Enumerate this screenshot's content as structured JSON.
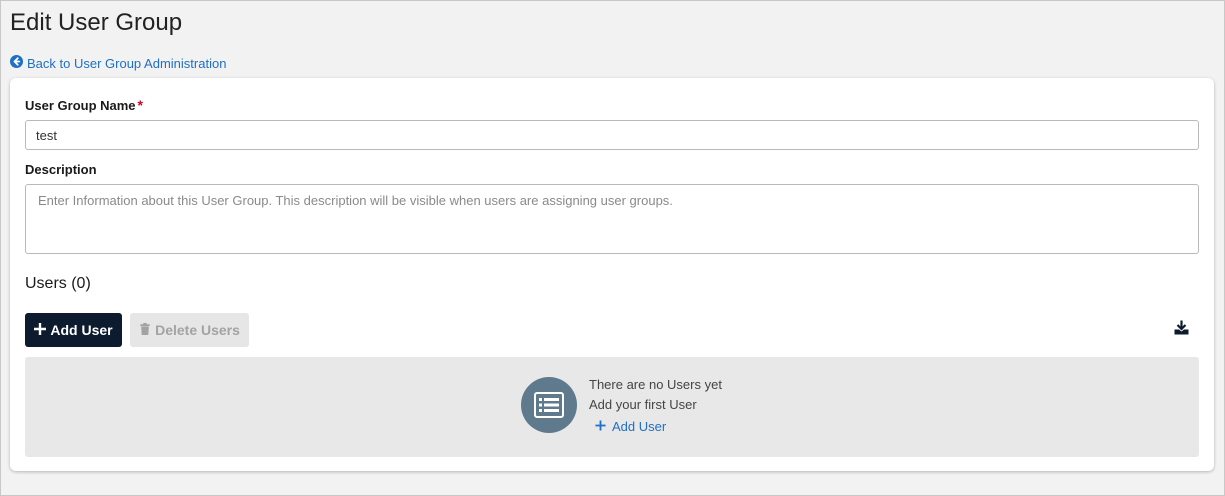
{
  "page": {
    "title": "Edit User Group",
    "back_link": "Back to User Group Administration"
  },
  "form": {
    "name_label": "User Group Name",
    "required_mark": "*",
    "name_value": "test",
    "description_label": "Description",
    "description_value": "",
    "description_placeholder": "Enter Information about this User Group. This description will be visible when users are assigning user groups."
  },
  "users": {
    "section_title": "Users (0)",
    "add_button": "Add User",
    "delete_button": "Delete Users",
    "empty_title": "There are no Users yet",
    "empty_subtitle": "Add your first User",
    "empty_add_link": "Add User"
  },
  "icons": {
    "back": "arrow-circle-left-icon",
    "add": "plus-icon",
    "delete": "trash-icon",
    "download": "download-icon",
    "empty": "list-icon"
  },
  "colors": {
    "link": "#1f6fc5",
    "primary_button": "#0d1b2e",
    "required": "#d0021b",
    "empty_icon_bg": "#5f7a8c"
  }
}
